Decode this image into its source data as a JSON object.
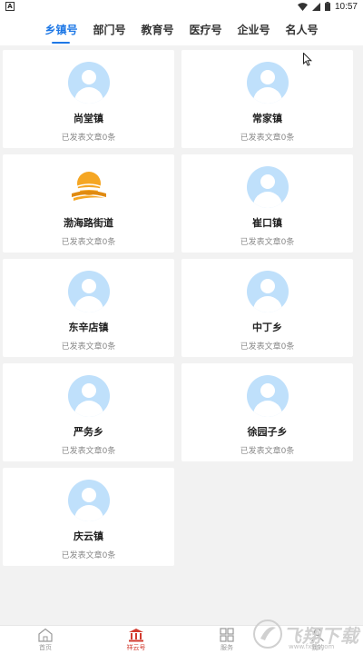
{
  "status_bar": {
    "left_icon": "A",
    "time": "10:57"
  },
  "tabs": [
    {
      "label": "乡镇号",
      "active": true
    },
    {
      "label": "部门号",
      "active": false
    },
    {
      "label": "教育号",
      "active": false
    },
    {
      "label": "医疗号",
      "active": false
    },
    {
      "label": "企业号",
      "active": false
    },
    {
      "label": "名人号",
      "active": false
    }
  ],
  "cards": [
    {
      "name": "尚堂镇",
      "count": "已发表文章0条",
      "avatar": "default-avatar-icon"
    },
    {
      "name": "常家镇",
      "count": "已发表文章0条",
      "avatar": "default-avatar-icon"
    },
    {
      "name": "渤海路街道",
      "count": "已发表文章0条",
      "avatar": "sunrise-logo"
    },
    {
      "name": "崔口镇",
      "count": "已发表文章0条",
      "avatar": "default-avatar-icon"
    },
    {
      "name": "东辛店镇",
      "count": "已发表文章0条",
      "avatar": "default-avatar-icon"
    },
    {
      "name": "中丁乡",
      "count": "已发表文章0条",
      "avatar": "default-avatar-icon"
    },
    {
      "name": "严务乡",
      "count": "已发表文章0条",
      "avatar": "default-avatar-icon"
    },
    {
      "name": "徐园子乡",
      "count": "已发表文章0条",
      "avatar": "default-avatar-icon"
    },
    {
      "name": "庆云镇",
      "count": "已发表文章0条",
      "avatar": "default-avatar-icon"
    }
  ],
  "bottom_nav": [
    {
      "label": "首页",
      "icon": "home-icon",
      "active": false
    },
    {
      "label": "祥云号",
      "icon": "building-icon",
      "active": true
    },
    {
      "label": "服务",
      "icon": "grid-icon",
      "active": false
    },
    {
      "label": "我的",
      "icon": "user-icon",
      "active": false
    }
  ],
  "watermark": {
    "text": "飞翔下载",
    "sub": "www.fxxz.com"
  },
  "colors": {
    "accent": "#1e78e6",
    "nav_active": "#d23b2f",
    "avatar_bg": "#bfe0fb"
  }
}
